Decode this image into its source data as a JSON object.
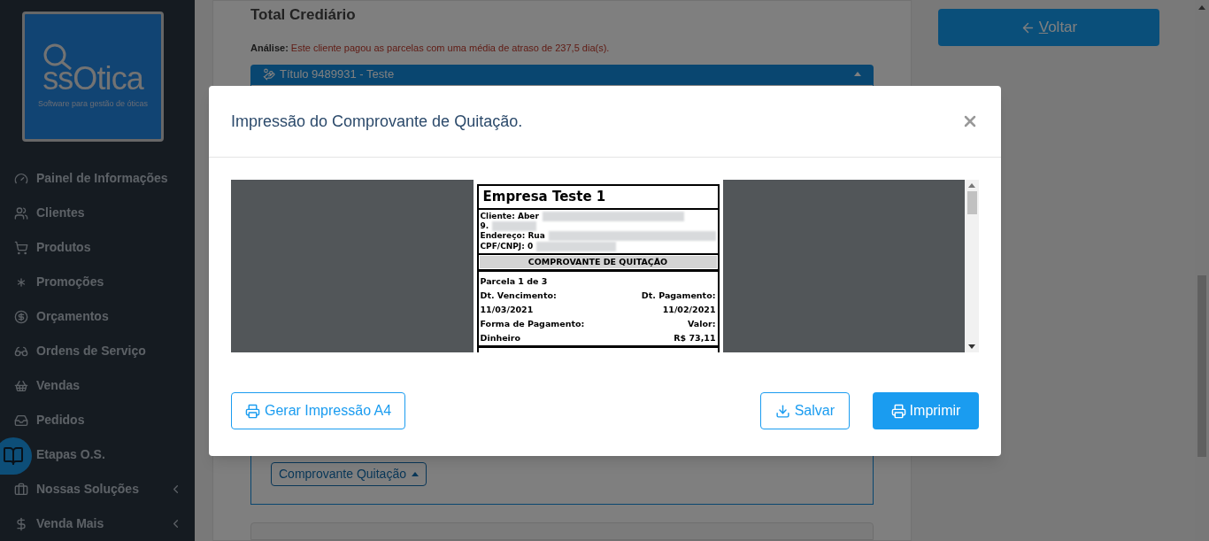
{
  "sidebar": {
    "logo": {
      "name": "ssOtica",
      "tagline": "Software para gestão de óticas"
    },
    "items": [
      {
        "label": "Painel de Informações",
        "has_submenu": false
      },
      {
        "label": "Clientes",
        "has_submenu": false
      },
      {
        "label": "Produtos",
        "has_submenu": false
      },
      {
        "label": "Promoções",
        "has_submenu": false
      },
      {
        "label": "Orçamentos",
        "has_submenu": false
      },
      {
        "label": "Ordens de Serviço",
        "has_submenu": false
      },
      {
        "label": "Vendas",
        "has_submenu": false
      },
      {
        "label": "Pedidos",
        "has_submenu": false
      },
      {
        "label": "Etapas O.S.",
        "has_submenu": false
      },
      {
        "label": "Nossas Soluções",
        "has_submenu": true
      },
      {
        "label": "Venda Mais",
        "has_submenu": true
      }
    ]
  },
  "page": {
    "heading": "Total Crediário",
    "analysis_label": "Análise:",
    "analysis_text": "Este cliente pagou as parcelas com uma média de atraso de 237,5 dia(s).",
    "titulo": {
      "label": "Título 9489931 - Teste",
      "expanded": true
    },
    "receipt_dropdown": "Comprovante Quitação",
    "back_button": "Voltar"
  },
  "modal": {
    "title": "Impressão do Comprovante de Quitação.",
    "document": {
      "company": "Empresa Teste 1",
      "client_lines": [
        "Cliente: Aber",
        "9.",
        "Endereço: Rua",
        "CPF/CNPJ: 0"
      ],
      "section_title": "COMPROVANTE DE QUITAÇÃO",
      "installments": [
        {
          "title": "Parcela 1 de 3",
          "due_label": "Dt. Vencimento:",
          "paid_label": "Dt. Pagamento:",
          "due": "11/03/2021",
          "paid": "11/02/2021",
          "method_label": "Forma de Pagamento:",
          "value_label": "Valor:",
          "method": "Dinheiro",
          "value": "R$ 73,11"
        }
      ]
    },
    "a4_button": "Gerar Impressão A4",
    "save_button": "Salvar",
    "print_button": "Imprimir"
  }
}
